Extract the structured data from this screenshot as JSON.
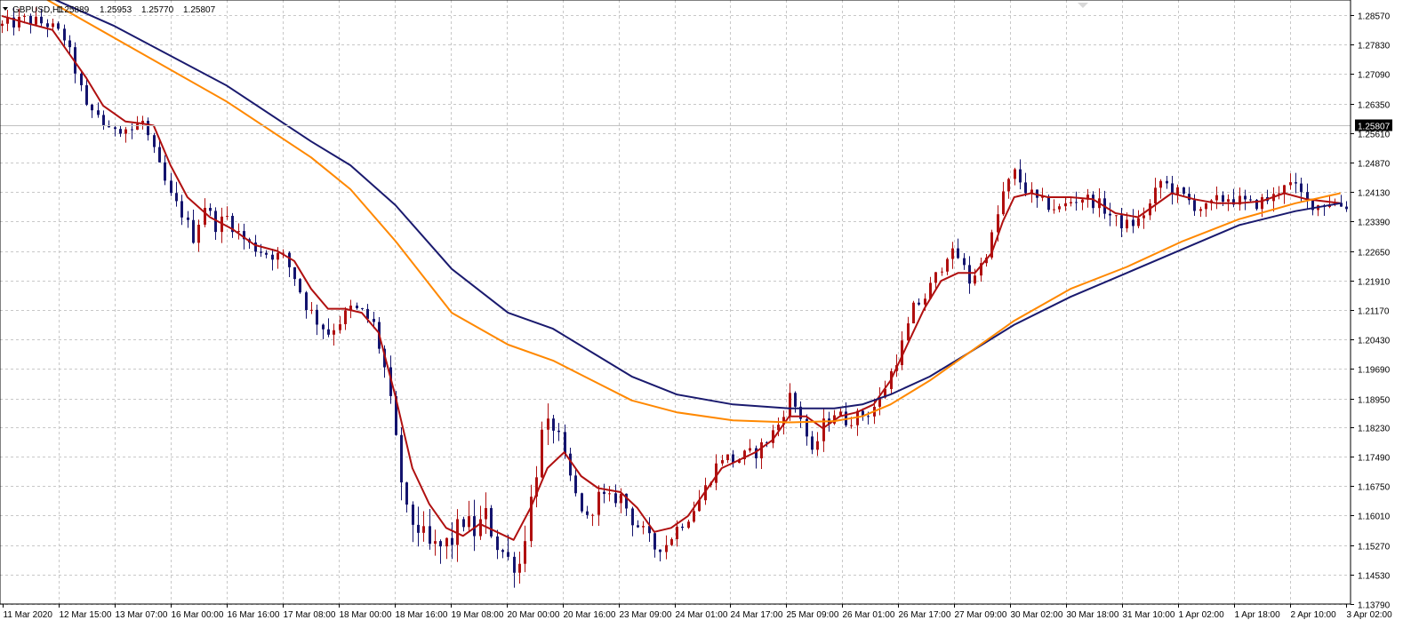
{
  "chart_data": {
    "type": "candlestick",
    "header": {
      "symbol": "GBPUSD,H1",
      "open": "1.25889",
      "high": "1.25953",
      "low": "1.25770",
      "close": "1.25807"
    },
    "current_price": "1.25807",
    "ylim": [
      1.1379,
      1.2895
    ],
    "y_ticks": [
      "1.28570",
      "1.27830",
      "1.27090",
      "1.26350",
      "1.25610",
      "1.24870",
      "1.24130",
      "1.23390",
      "1.22650",
      "1.21910",
      "1.21170",
      "1.20430",
      "1.19690",
      "1.18950",
      "1.18230",
      "1.17490",
      "1.16750",
      "1.16010",
      "1.15270",
      "1.14530",
      "1.13790"
    ],
    "x_ticks": [
      "11 Mar 2020",
      "12 Mar 15:00",
      "13 Mar 07:00",
      "16 Mar 00:00",
      "16 Mar 16:00",
      "17 Mar 08:00",
      "18 Mar 00:00",
      "18 Mar 16:00",
      "19 Mar 08:00",
      "20 Mar 00:00",
      "20 Mar 16:00",
      "23 Mar 09:00",
      "24 Mar 01:00",
      "24 Mar 17:00",
      "25 Mar 09:00",
      "26 Mar 01:00",
      "26 Mar 17:00",
      "27 Mar 09:00",
      "30 Mar 02:00",
      "30 Mar 18:00",
      "31 Mar 10:00",
      "1 Apr 02:00",
      "1 Apr 18:00",
      "2 Apr 10:00",
      "3 Apr 02:00"
    ],
    "price_path": [
      [
        0,
        1.283
      ],
      [
        4,
        1.2845
      ],
      [
        8,
        1.2835
      ],
      [
        11,
        1.28
      ],
      [
        13,
        1.272
      ],
      [
        15,
        1.262
      ],
      [
        17,
        1.261
      ],
      [
        19,
        1.256
      ],
      [
        20,
        1.258
      ],
      [
        23,
        1.257
      ],
      [
        25,
        1.259
      ],
      [
        27,
        1.251
      ],
      [
        30,
        1.24
      ],
      [
        32,
        1.236
      ],
      [
        34,
        1.23
      ],
      [
        36,
        1.238
      ],
      [
        38,
        1.233
      ],
      [
        40,
        1.235
      ],
      [
        42,
        1.231
      ],
      [
        44,
        1.228
      ],
      [
        47,
        1.226
      ],
      [
        50,
        1.225
      ],
      [
        52,
        1.22
      ],
      [
        54,
        1.213
      ],
      [
        56,
        1.209
      ],
      [
        58,
        1.206
      ],
      [
        60,
        1.209
      ],
      [
        62,
        1.212
      ],
      [
        64,
        1.211
      ],
      [
        66,
        1.208
      ],
      [
        68,
        1.197
      ],
      [
        70,
        1.178
      ],
      [
        72,
        1.16
      ],
      [
        74,
        1.157
      ],
      [
        76,
        1.152
      ],
      [
        78,
        1.152
      ],
      [
        80,
        1.154
      ],
      [
        82,
        1.159
      ],
      [
        84,
        1.156
      ],
      [
        86,
        1.16
      ],
      [
        88,
        1.153
      ],
      [
        90,
        1.149
      ],
      [
        92,
        1.148
      ],
      [
        94,
        1.164
      ],
      [
        96,
        1.18
      ],
      [
        98,
        1.183
      ],
      [
        100,
        1.174
      ],
      [
        102,
        1.165
      ],
      [
        104,
        1.159
      ],
      [
        106,
        1.165
      ],
      [
        108,
        1.164
      ],
      [
        110,
        1.165
      ],
      [
        112,
        1.159
      ],
      [
        114,
        1.156
      ],
      [
        116,
        1.152
      ],
      [
        118,
        1.153
      ],
      [
        120,
        1.157
      ],
      [
        122,
        1.16
      ],
      [
        124,
        1.164
      ],
      [
        126,
        1.17
      ],
      [
        128,
        1.175
      ],
      [
        130,
        1.174
      ],
      [
        132,
        1.175
      ],
      [
        134,
        1.176
      ],
      [
        136,
        1.179
      ],
      [
        138,
        1.183
      ],
      [
        140,
        1.19
      ],
      [
        142,
        1.185
      ],
      [
        144,
        1.175
      ],
      [
        146,
        1.183
      ],
      [
        148,
        1.186
      ],
      [
        150,
        1.184
      ],
      [
        152,
        1.185
      ],
      [
        154,
        1.186
      ],
      [
        156,
        1.189
      ],
      [
        158,
        1.196
      ],
      [
        160,
        1.203
      ],
      [
        162,
        1.212
      ],
      [
        164,
        1.215
      ],
      [
        166,
        1.22
      ],
      [
        168,
        1.226
      ],
      [
        170,
        1.225
      ],
      [
        172,
        1.219
      ],
      [
        174,
        1.223
      ],
      [
        176,
        1.23
      ],
      [
        178,
        1.241
      ],
      [
        180,
        1.246
      ],
      [
        182,
        1.242
      ],
      [
        184,
        1.239
      ],
      [
        186,
        1.238
      ],
      [
        188,
        1.237
      ],
      [
        190,
        1.239
      ],
      [
        192,
        1.24
      ],
      [
        194,
        1.239
      ],
      [
        196,
        1.237
      ],
      [
        198,
        1.234
      ],
      [
        200,
        1.233
      ],
      [
        202,
        1.234
      ],
      [
        204,
        1.238
      ],
      [
        206,
        1.244
      ],
      [
        208,
        1.242
      ],
      [
        210,
        1.24
      ],
      [
        212,
        1.238
      ],
      [
        214,
        1.237
      ],
      [
        216,
        1.239
      ],
      [
        218,
        1.24
      ],
      [
        220,
        1.239
      ],
      [
        222,
        1.238
      ],
      [
        224,
        1.239
      ],
      [
        226,
        1.24
      ],
      [
        228,
        1.244
      ],
      [
        230,
        1.242
      ],
      [
        232,
        1.239
      ],
      [
        234,
        1.238
      ],
      [
        236,
        1.239
      ],
      [
        238,
        1.238
      ]
    ],
    "series": [
      {
        "kind": "ma_fast",
        "color": "#b01010",
        "points": [
          [
            0,
            1.2855
          ],
          [
            5,
            1.2835
          ],
          [
            9,
            1.282
          ],
          [
            12,
            1.276
          ],
          [
            15,
            1.27
          ],
          [
            18,
            1.263
          ],
          [
            22,
            1.259
          ],
          [
            25,
            1.2585
          ],
          [
            27,
            1.258
          ],
          [
            30,
            1.248
          ],
          [
            33,
            1.24
          ],
          [
            37,
            1.235
          ],
          [
            41,
            1.232
          ],
          [
            45,
            1.228
          ],
          [
            49,
            1.2265
          ],
          [
            52,
            1.224
          ],
          [
            55,
            1.217
          ],
          [
            58,
            1.212
          ],
          [
            61,
            1.212
          ],
          [
            64,
            1.211
          ],
          [
            67,
            1.206
          ],
          [
            70,
            1.19
          ],
          [
            73,
            1.172
          ],
          [
            76,
            1.163
          ],
          [
            79,
            1.157
          ],
          [
            82,
            1.155
          ],
          [
            85,
            1.158
          ],
          [
            88,
            1.156
          ],
          [
            91,
            1.154
          ],
          [
            94,
            1.162
          ],
          [
            97,
            1.172
          ],
          [
            100,
            1.176
          ],
          [
            103,
            1.17
          ],
          [
            106,
            1.167
          ],
          [
            110,
            1.166
          ],
          [
            113,
            1.162
          ],
          [
            116,
            1.156
          ],
          [
            119,
            1.157
          ],
          [
            122,
            1.16
          ],
          [
            125,
            1.166
          ],
          [
            128,
            1.172
          ],
          [
            131,
            1.174
          ],
          [
            134,
            1.176
          ],
          [
            137,
            1.179
          ],
          [
            140,
            1.185
          ],
          [
            143,
            1.185
          ],
          [
            146,
            1.182
          ],
          [
            149,
            1.185
          ],
          [
            152,
            1.186
          ],
          [
            155,
            1.188
          ],
          [
            158,
            1.194
          ],
          [
            161,
            1.203
          ],
          [
            164,
            1.212
          ],
          [
            167,
            1.219
          ],
          [
            170,
            1.221
          ],
          [
            173,
            1.221
          ],
          [
            176,
            1.226
          ],
          [
            178,
            1.234
          ],
          [
            180,
            1.24
          ],
          [
            183,
            1.241
          ],
          [
            186,
            1.24
          ],
          [
            190,
            1.24
          ],
          [
            194,
            1.2395
          ],
          [
            198,
            1.236
          ],
          [
            202,
            1.235
          ],
          [
            205,
            1.238
          ],
          [
            208,
            1.241
          ],
          [
            212,
            1.2395
          ],
          [
            216,
            1.2385
          ],
          [
            220,
            1.2385
          ],
          [
            224,
            1.239
          ],
          [
            228,
            1.241
          ],
          [
            232,
            1.2395
          ],
          [
            238,
            1.2385
          ]
        ]
      },
      {
        "kind": "ma_slow",
        "color": "#1a1a6e",
        "points": [
          [
            0,
            1.2955
          ],
          [
            20,
            1.283
          ],
          [
            40,
            1.268
          ],
          [
            55,
            1.254
          ],
          [
            62,
            1.248
          ],
          [
            70,
            1.238
          ],
          [
            80,
            1.222
          ],
          [
            90,
            1.211
          ],
          [
            98,
            1.207
          ],
          [
            105,
            1.201
          ],
          [
            112,
            1.195
          ],
          [
            120,
            1.1905
          ],
          [
            130,
            1.188
          ],
          [
            140,
            1.187
          ],
          [
            148,
            1.187
          ],
          [
            153,
            1.188
          ],
          [
            158,
            1.1905
          ],
          [
            165,
            1.195
          ],
          [
            172,
            1.201
          ],
          [
            180,
            1.208
          ],
          [
            190,
            1.215
          ],
          [
            200,
            1.221
          ],
          [
            210,
            1.227
          ],
          [
            220,
            1.233
          ],
          [
            230,
            1.2365
          ],
          [
            238,
            1.2385
          ]
        ]
      },
      {
        "kind": "ma_slow_2",
        "color": "#ff8800",
        "points": [
          [
            0,
            1.296
          ],
          [
            20,
            1.28
          ],
          [
            40,
            1.264
          ],
          [
            55,
            1.25
          ],
          [
            62,
            1.242
          ],
          [
            70,
            1.229
          ],
          [
            80,
            1.211
          ],
          [
            90,
            1.203
          ],
          [
            98,
            1.199
          ],
          [
            105,
            1.194
          ],
          [
            112,
            1.189
          ],
          [
            120,
            1.186
          ],
          [
            130,
            1.184
          ],
          [
            140,
            1.1835
          ],
          [
            148,
            1.1838
          ],
          [
            153,
            1.185
          ],
          [
            158,
            1.188
          ],
          [
            165,
            1.194
          ],
          [
            172,
            1.201
          ],
          [
            180,
            1.209
          ],
          [
            190,
            1.217
          ],
          [
            200,
            1.2225
          ],
          [
            210,
            1.229
          ],
          [
            220,
            1.2345
          ],
          [
            230,
            1.2385
          ],
          [
            238,
            1.241
          ]
        ]
      }
    ]
  }
}
